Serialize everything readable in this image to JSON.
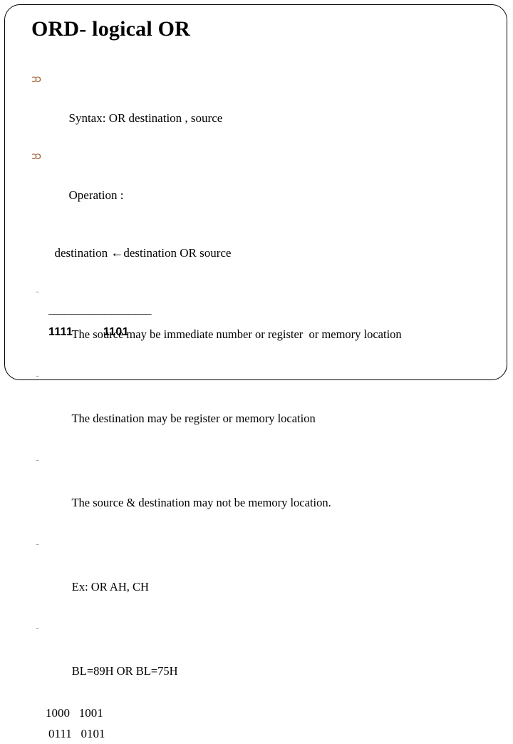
{
  "slide": {
    "title": "ORD- logical OR",
    "background_color": "#ffffff",
    "border_color": "#000000",
    "bullet_glyph_color": "#9b5f34",
    "dash_glyph_color": "#b4a596",
    "text_color": "#000000"
  },
  "bullets": [
    {
      "glyph": "ɔɔ",
      "text": "Syntax: OR destination , source"
    },
    {
      "glyph": "ɔɔ",
      "text": "Operation :"
    }
  ],
  "operation_line": {
    "prefix": "destination ",
    "arrow": "←",
    "suffix": "destination OR source"
  },
  "sub_items": [
    {
      "dash": "-",
      "text": "The source may be immediate number or register  or memory location"
    },
    {
      "dash": "-",
      "text": "The destination may be register or memory location"
    },
    {
      "dash": "-",
      "text": "The source & destination may not be memory location."
    },
    {
      "dash": "-",
      "text": "Ex: OR AH, CH"
    },
    {
      "dash": "-",
      "text": "BL=89H OR BL=75H"
    }
  ],
  "binary": {
    "operand_1": "1000   1001",
    "operand_2": "0111   0101",
    "rule": "__________________",
    "result": "1111         1101"
  }
}
